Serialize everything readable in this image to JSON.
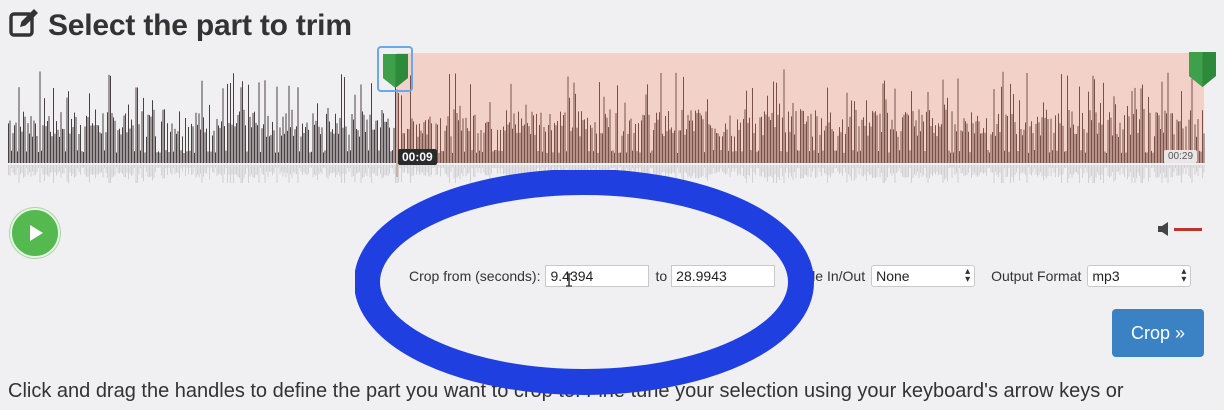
{
  "header": {
    "title": "Select the part to trim",
    "icon": "edit-icon"
  },
  "waveform": {
    "start_time": "00:09",
    "end_time": "00:29",
    "selection_start_fraction": 0.324,
    "colors": {
      "unselected": "#4a4042",
      "selected": "#7a5048",
      "selection_bg": "#f2d2c8",
      "handle": "#2d8a3a"
    }
  },
  "player": {
    "play_icon": "play-icon",
    "play_color": "#54b94f",
    "volume_icon": "speaker-icon"
  },
  "crop": {
    "from_label": "Crop from (seconds):",
    "from_value": "9.4394",
    "to_label": "to",
    "to_value": "28.9943",
    "fade_label": "Fade In/Out",
    "fade_value": "None",
    "format_label": "Output Format",
    "format_value": "mp3",
    "button_label": "Crop »",
    "button_color": "#3a82c4"
  },
  "help": {
    "text": "Click and drag the handles to define the part you want to crop to. Fine tune your selection using your keyboard's arrow keys or"
  },
  "annotation": {
    "color": "#1f3fe0"
  }
}
